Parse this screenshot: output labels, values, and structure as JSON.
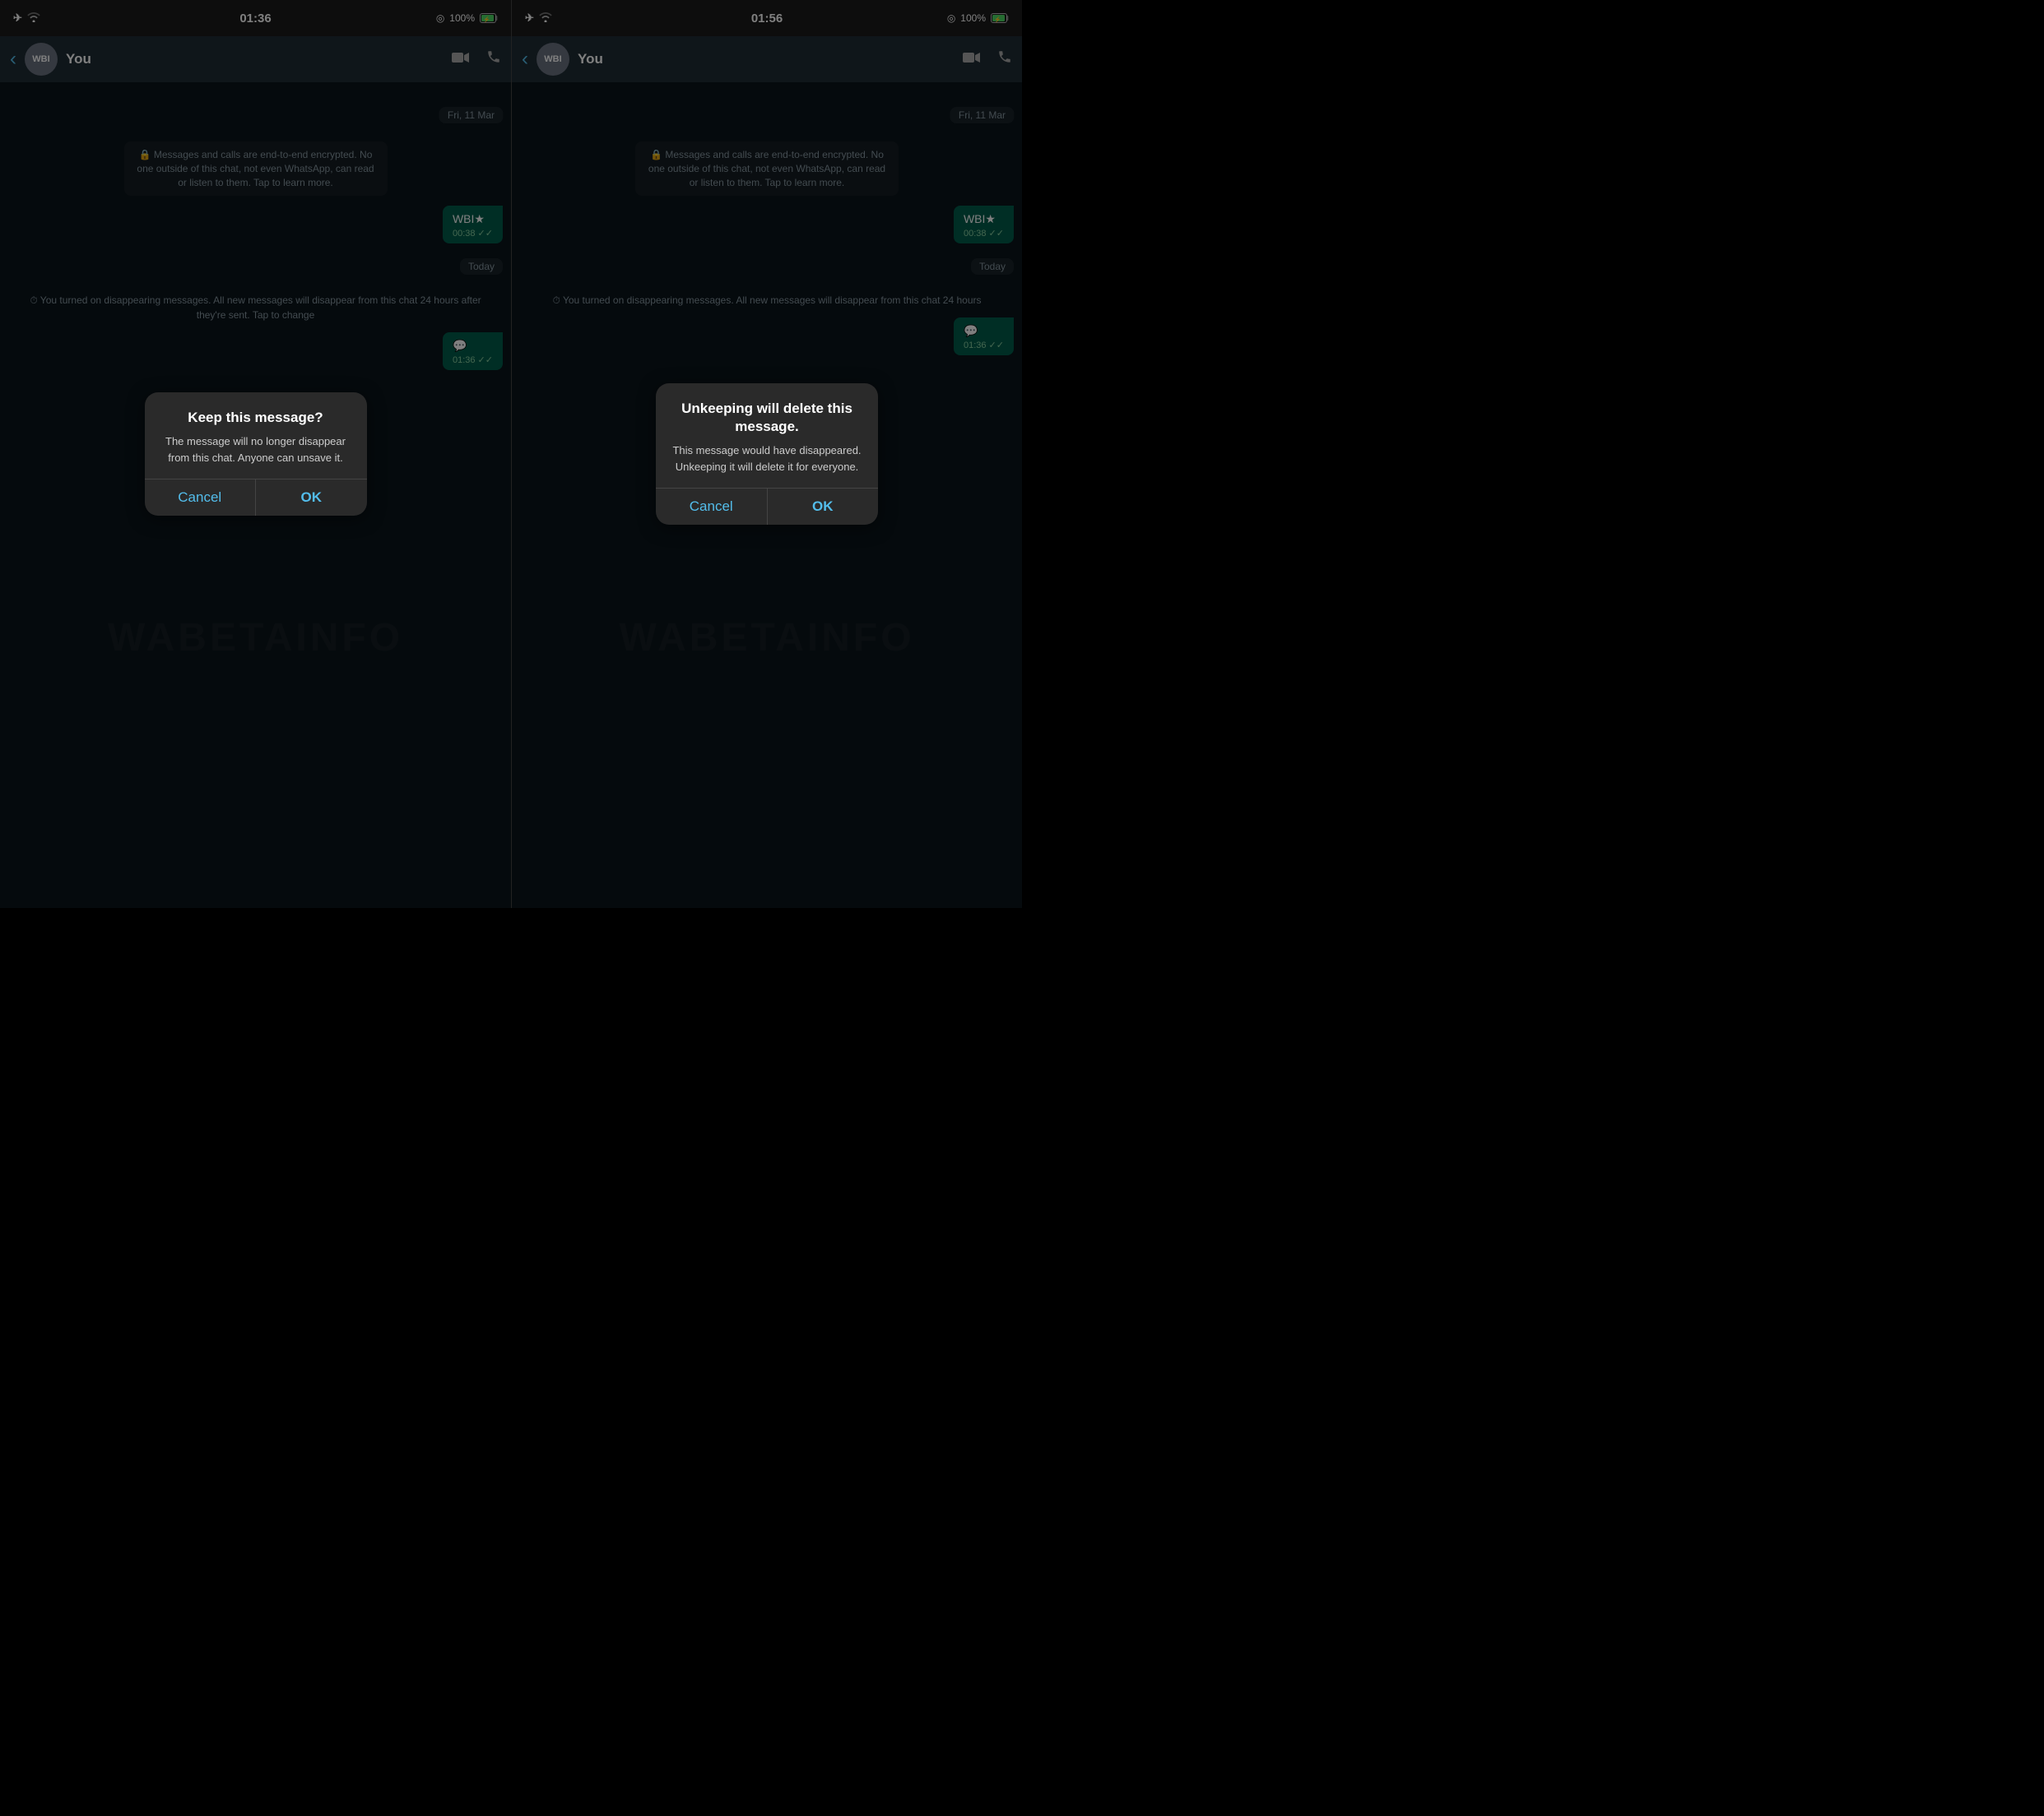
{
  "panels": [
    {
      "id": "left",
      "statusBar": {
        "time": "01:36",
        "battery": "100%",
        "showAirplane": true,
        "showWifi": true
      },
      "header": {
        "backLabel": "‹",
        "avatarText": "WBI",
        "contactName": "You"
      },
      "chat": {
        "dateFri": "Fri, 11 Mar",
        "encryptionNotice": "🔒 Messages and calls are end-to-end encrypted. No one outside of this chat, not even WhatsApp, can read or listen to them. Tap to learn more.",
        "messageText": "WBI★",
        "messageTime": "00:38",
        "todayLabel": "Today",
        "disappearingText": "⏱ You turned on disappearing messages. All new messages will disappear from this chat 24 hours after they're sent. Tap to change",
        "bubbleTime2": "01:36"
      },
      "dialog": {
        "title": "Keep this message?",
        "message": "The message will no longer disappear from this chat. Anyone can unsave it.",
        "cancelLabel": "Cancel",
        "okLabel": "OK"
      }
    },
    {
      "id": "right",
      "statusBar": {
        "time": "01:56",
        "battery": "100%",
        "showAirplane": true,
        "showWifi": true
      },
      "header": {
        "backLabel": "‹",
        "avatarText": "WBI",
        "contactName": "You"
      },
      "chat": {
        "dateFri": "Fri, 11 Mar",
        "encryptionNotice": "🔒 Messages and calls are end-to-end encrypted. No one outside of this chat, not even WhatsApp, can read or listen to them. Tap to learn more.",
        "messageText": "WBI★",
        "messageTime": "00:38",
        "todayLabel": "Today",
        "disappearingText": "⏱ You turned on disappearing messages. All new messages will disappear from this chat 24 hours",
        "bubbleTime2": "01:36"
      },
      "dialog": {
        "title": "Unkeeping will delete this message.",
        "message": "This message would have disappeared. Unkeeping it will delete it for everyone.",
        "cancelLabel": "Cancel",
        "okLabel": "OK"
      }
    }
  ],
  "colors": {
    "accent": "#53bdeb",
    "bg": "#0b141a",
    "header": "#1f2c34",
    "bubble": "#005c4b",
    "dialog": "#2a2a2a",
    "statusBar": "#1a1a1a"
  }
}
